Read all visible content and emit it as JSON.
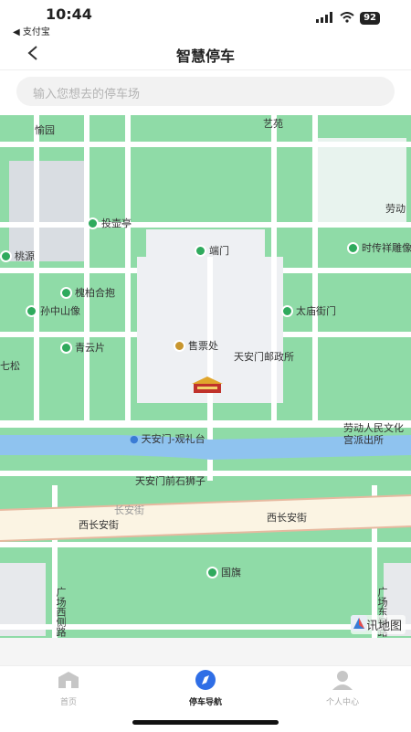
{
  "status": {
    "time": "10:44",
    "back_app": "◀ 支付宝",
    "battery": "92"
  },
  "header": {
    "title": "智慧停车"
  },
  "search": {
    "placeholder": "输入您想去的停车场"
  },
  "map": {
    "pois": [
      {
        "name": "艺苑"
      },
      {
        "name": "愉园"
      },
      {
        "name": "劳动"
      },
      {
        "name": "投壶亭"
      },
      {
        "name": "桃源"
      },
      {
        "name": "端门"
      },
      {
        "name": "时传祥雕像"
      },
      {
        "name": "槐柏合抱"
      },
      {
        "name": "孙中山像"
      },
      {
        "name": "太庙街门"
      },
      {
        "name": "青云片"
      },
      {
        "name": "七松"
      },
      {
        "name": "售票处"
      },
      {
        "name": "天安门邮政所"
      },
      {
        "name": "劳动人民文化宫派出所"
      },
      {
        "name": "天安门-观礼台"
      },
      {
        "name": "天安门前石狮子"
      },
      {
        "name": "长安街"
      },
      {
        "name": "西长安街"
      },
      {
        "name": "西长安街"
      },
      {
        "name": "国旗"
      },
      {
        "name": "广场西侧路"
      },
      {
        "name": "广场东侧路"
      }
    ],
    "watermark": "腾讯地图"
  },
  "tabs": [
    {
      "label": "首页",
      "icon": "home-icon",
      "active": false
    },
    {
      "label": "停车导航",
      "icon": "compass-icon",
      "active": true
    },
    {
      "label": "个人中心",
      "icon": "user-icon",
      "active": false
    }
  ]
}
